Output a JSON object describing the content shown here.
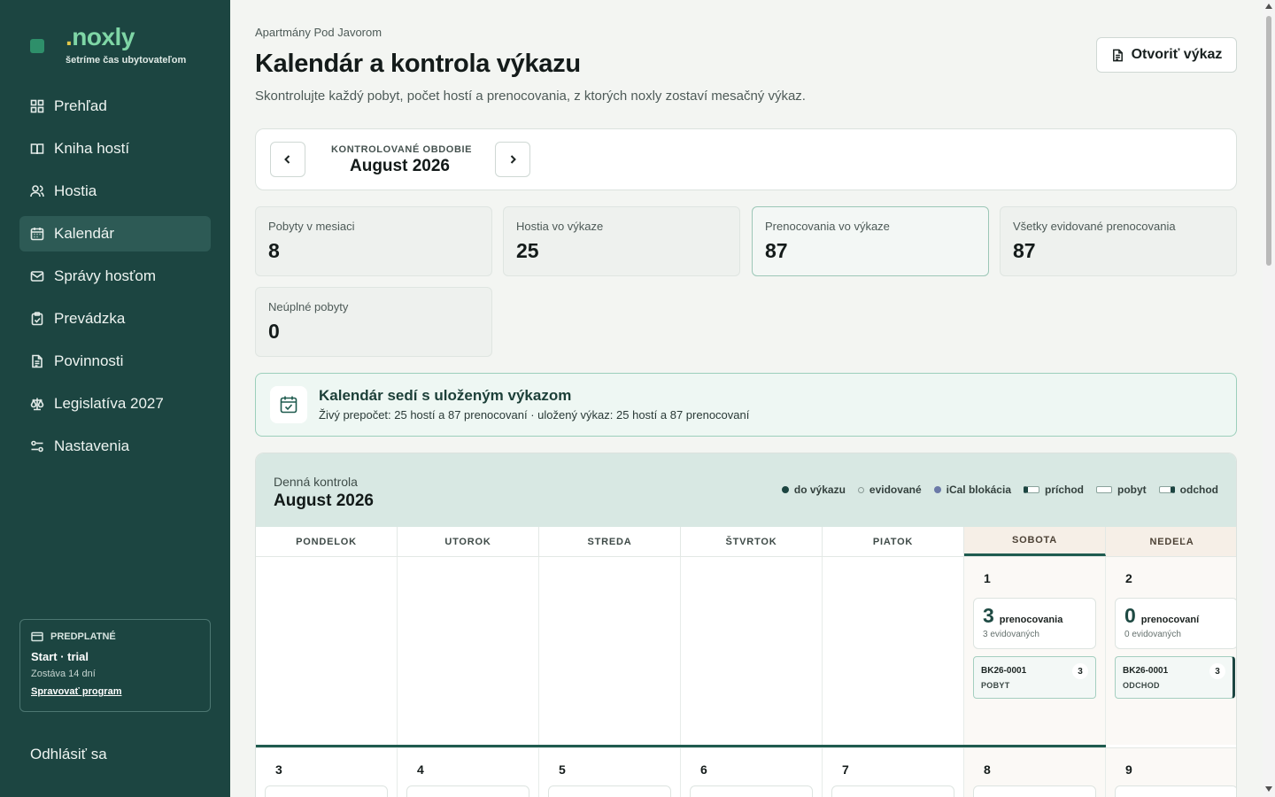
{
  "brand": {
    "dot": ".",
    "name": "noxly",
    "tagline": "šetríme čas ubytovateľom"
  },
  "sidebar": {
    "items": [
      {
        "label": "Prehľad",
        "icon": "dashboard-icon",
        "active": false
      },
      {
        "label": "Kniha hostí",
        "icon": "book-icon",
        "active": false
      },
      {
        "label": "Hostia",
        "icon": "users-icon",
        "active": false
      },
      {
        "label": "Kalendár",
        "icon": "calendar-icon",
        "active": true
      },
      {
        "label": "Správy hosťom",
        "icon": "mail-icon",
        "active": false
      },
      {
        "label": "Prevádzka",
        "icon": "clipboard-icon",
        "active": false
      },
      {
        "label": "Povinnosti",
        "icon": "document-icon",
        "active": false
      },
      {
        "label": "Legislatíva 2027",
        "icon": "scale-icon",
        "active": false
      },
      {
        "label": "Nastavenia",
        "icon": "settings-icon",
        "active": false
      }
    ],
    "plan": {
      "label": "PREDPLATNÉ",
      "title": "Start · trial",
      "remaining": "Zostáva 14 dní",
      "link": "Spravovať program"
    },
    "logout": "Odhlásiť sa"
  },
  "header": {
    "breadcrumb": "Apartmány Pod Javorom",
    "title": "Kalendár a kontrola výkazu",
    "subtitle": "Skontrolujte každý pobyt, počet hostí a prenocovania, z ktorých noxly zostaví mesačný výkaz.",
    "open_button": "Otvoriť výkaz"
  },
  "period": {
    "label": "KONTROLOVANÉ OBDOBIE",
    "value": "August 2026"
  },
  "stats": [
    {
      "label": "Pobyty v mesiaci",
      "value": "8"
    },
    {
      "label": "Hostia vo výkaze",
      "value": "25"
    },
    {
      "label": "Prenocovania vo výkaze",
      "value": "87"
    },
    {
      "label": "Všetky evidované prenocovania",
      "value": "87"
    },
    {
      "label": "Neúplné pobyty",
      "value": "0"
    }
  ],
  "banner": {
    "title": "Kalendár sedí s uloženým výkazom",
    "text": "Živý prepočet: 25 hostí a 87 prenocovaní · uložený výkaz: 25 hostí a 87 prenocovaní"
  },
  "calendar": {
    "kicker": "Denná kontrola",
    "month": "August 2026",
    "legend": [
      {
        "label": "do výkazu",
        "color": "#1c4541"
      },
      {
        "label": "evidované",
        "color": "#8a9a96"
      },
      {
        "label": "iCal blokácia",
        "color": "#6b7aa8"
      },
      {
        "label": "príchod"
      },
      {
        "label": "pobyt"
      },
      {
        "label": "odchod"
      }
    ],
    "weekdays": [
      "PONDELOK",
      "UTOROK",
      "STREDA",
      "ŠTVRTOK",
      "PIATOK",
      "SOBOTA",
      "NEDEĽA"
    ],
    "week1": {
      "sat": {
        "num": "1",
        "count": "3",
        "count_word": "prenocovania",
        "registered": "3 evidovaných",
        "booking": {
          "code": "BK26-0001",
          "guests": "3",
          "type": "POBYT"
        }
      },
      "sun": {
        "num": "2",
        "count": "0",
        "count_word": "prenocovaní",
        "registered": "0 evidovaných",
        "booking": {
          "code": "BK26-0001",
          "guests": "3",
          "type": "ODCHOD"
        }
      }
    },
    "week2_days": [
      "3",
      "4",
      "5",
      "6",
      "7",
      "8",
      "9"
    ]
  }
}
